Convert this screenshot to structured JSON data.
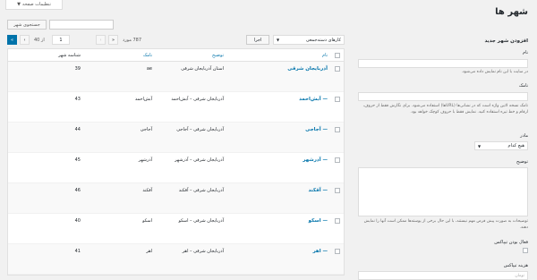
{
  "screen_options": {
    "label": "تنظیمات صفحه",
    "arrow": "▼"
  },
  "page": {
    "title": "شهر ها"
  },
  "search": {
    "placeholder": "",
    "button": "جستجوی شهر"
  },
  "form": {
    "section_title": "افزودن شهر جدید",
    "name_label": "نام",
    "name_desc": "در سایت با این نام نمایش داده می‌شود.",
    "slug_label": "نامک",
    "slug_desc": "نامک نسخه لاتین واژه است که در نشانی‌ها (URLها) استفاده می‌شود. برای نگارش‌ فقط از حروف، ارقام و خط تیره استفاده کنید. نمایش فقط با حروف کوچک خواهد بود.",
    "parent_label": "مادر",
    "parent_value": "هیچ کدام",
    "desc_label": "توضیح",
    "desc_desc": "توضیحات به صورت پیش فرض مهم نیستند، با این حال برخی از پوسته‌ها ممکن است آنها را نمایش دهند.",
    "active_label": "فعال بودن تیپاکس",
    "cost_label": "هزینه تیپاکس",
    "cost_placeholder": "تومان"
  },
  "toolbar": {
    "bulk_select": "کارهای دسته‌جمعی",
    "apply": "اجرا",
    "items_count": "787 مورد",
    "first": "«",
    "prev": "‹",
    "current_page": "1",
    "of_pages": "از 40",
    "next": "›",
    "last": "»"
  },
  "table": {
    "headers": {
      "name": "نام",
      "description": "توضیح",
      "slug": "نامک",
      "id": "شناسه شهر"
    },
    "rows": [
      {
        "name": "آذربایجان شرقی",
        "description": "استان آذربایجان شرقی",
        "slug": "ae",
        "id": "39"
      },
      {
        "name": "— آبش‌احمد",
        "description": "آذربایجان شرقی – آبش‌احمد",
        "slug": "آبش‌احمد",
        "id": "43"
      },
      {
        "name": "— آجاجی",
        "description": "آذربایجان شرقی – آجاجی",
        "slug": "آجاجی",
        "id": "44"
      },
      {
        "name": "— آذرشهر",
        "description": "آذربایجان شرقی – آذرشهر",
        "slug": "آذرشهر",
        "id": "45"
      },
      {
        "name": "— آقکند",
        "description": "آذربایجان شرقی – آقکند",
        "slug": "آقکند",
        "id": "46"
      },
      {
        "name": "— اسکو",
        "description": "آذربایجان شرقی – اسکو",
        "slug": "اسکو",
        "id": "40"
      },
      {
        "name": "— اهر",
        "description": "آذربایجان شرقی – اهر",
        "slug": "اهر",
        "id": "41"
      }
    ]
  }
}
